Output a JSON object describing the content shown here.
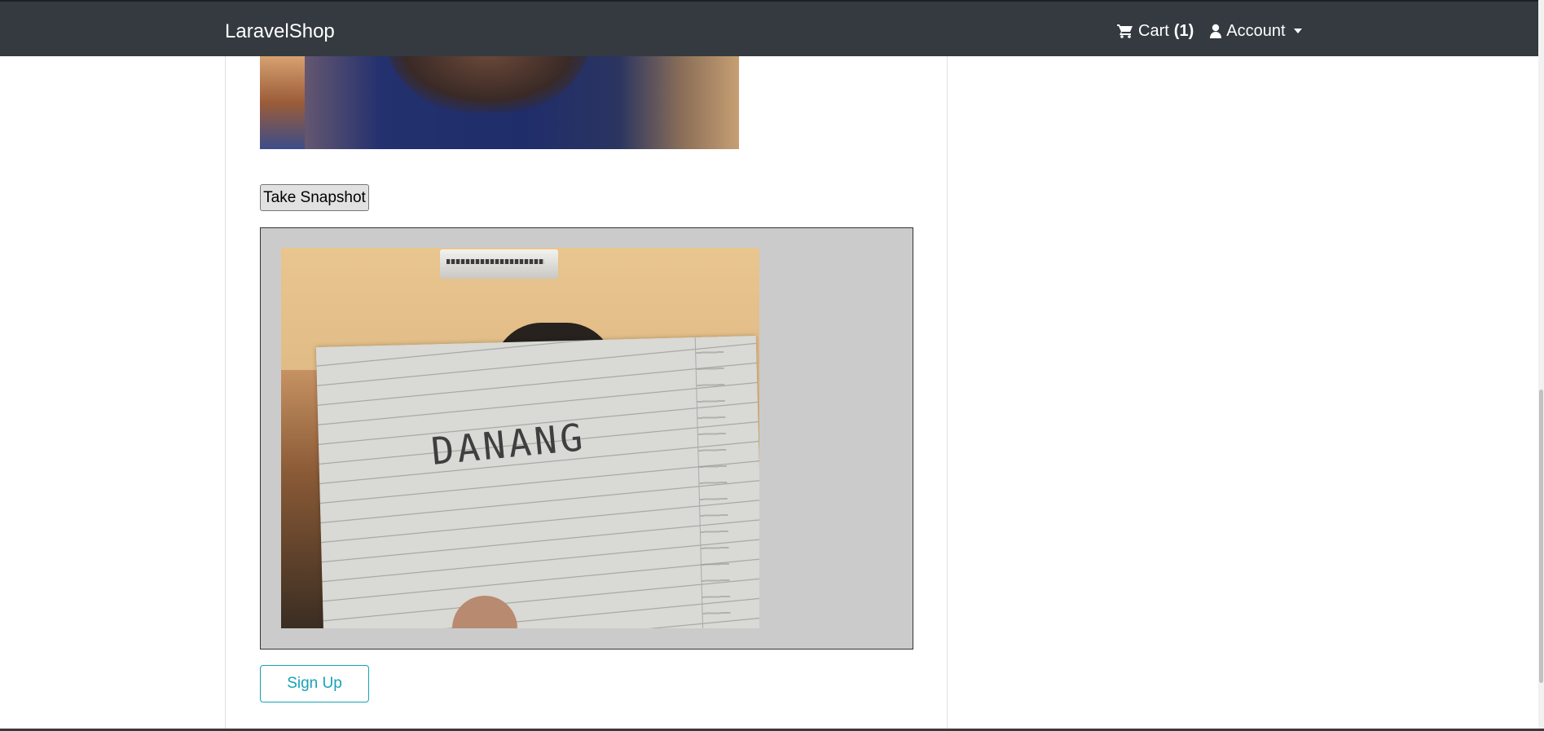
{
  "navbar": {
    "brand": "LaravelShop",
    "cart_label": "Cart",
    "cart_count": "(1)",
    "account_label": "Account"
  },
  "camera": {
    "snapshot_button_label": "Take Snapshot"
  },
  "form": {
    "signup_button_label": "Sign Up"
  },
  "snapshot_image": {
    "handwritten_text": "DANANG"
  },
  "colors": {
    "navbar_bg": "#343a40",
    "signup_accent": "#17a2b8",
    "result_box_bg": "#cbcbcb"
  },
  "icons": {
    "cart": "shopping-cart-icon",
    "account": "user-icon",
    "dropdown": "caret-down-icon"
  }
}
